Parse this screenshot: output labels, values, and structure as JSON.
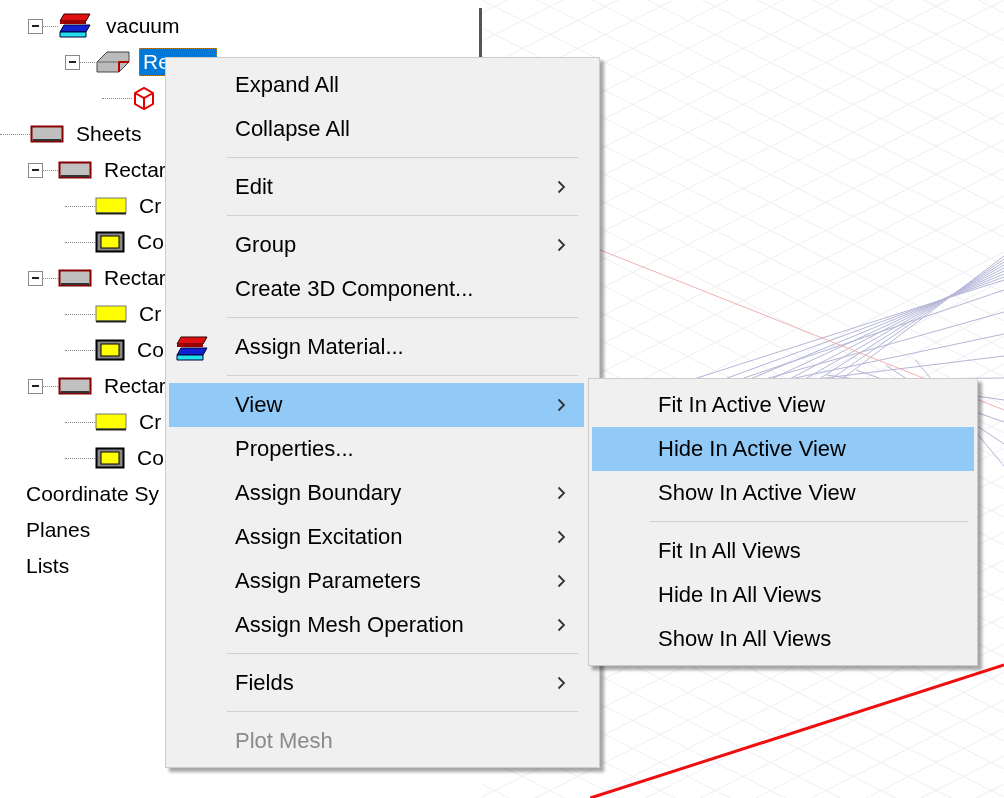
{
  "tree": {
    "partial_branch": [
      {
        "label": "vacuum",
        "kind": "material",
        "expanded": true,
        "selected": false,
        "children": [
          {
            "label": "Re",
            "kind": "solid",
            "expanded": true,
            "selected": true,
            "children": [
              {
                "kind": "wire",
                "selected": false
              }
            ]
          }
        ]
      }
    ],
    "items": [
      {
        "label": "Sheets",
        "kind": "sheet",
        "selected": false,
        "children": [
          {
            "label": "Rectar",
            "kind": "sheet",
            "expanded": true,
            "selected": false,
            "children": [
              {
                "label": "Cr",
                "kind": "face",
                "selected": false
              },
              {
                "label": "Co",
                "kind": "framed",
                "selected": false
              }
            ]
          },
          {
            "label": "Rectar",
            "kind": "sheet",
            "expanded": true,
            "selected": false,
            "children": [
              {
                "label": "Cr",
                "kind": "face",
                "selected": false
              },
              {
                "label": "Co",
                "kind": "framed",
                "selected": false
              }
            ]
          },
          {
            "label": "Rectar",
            "kind": "sheet",
            "expanded": true,
            "selected": false,
            "children": [
              {
                "label": "Cr",
                "kind": "face",
                "selected": false
              },
              {
                "label": "Co",
                "kind": "framed",
                "selected": false
              }
            ]
          }
        ]
      },
      {
        "label": "Coordinate Sy",
        "kind": "none",
        "selected": false
      },
      {
        "label": "Planes",
        "kind": "none",
        "selected": false
      },
      {
        "label": "Lists",
        "kind": "none",
        "selected": false
      }
    ]
  },
  "context_menu": {
    "groups": [
      [
        {
          "label": "Expand All",
          "kind": "text",
          "submenu": false,
          "selected": false,
          "disabled": false
        },
        {
          "label": "Collapse All",
          "kind": "text",
          "submenu": false,
          "selected": false,
          "disabled": false
        }
      ],
      [
        {
          "label": "Edit",
          "kind": "text",
          "submenu": true,
          "selected": false,
          "disabled": false
        }
      ],
      [
        {
          "label": "Group",
          "kind": "text",
          "submenu": true,
          "selected": false,
          "disabled": false
        },
        {
          "label": "Create 3D Component...",
          "kind": "text",
          "submenu": false,
          "selected": false,
          "disabled": false
        }
      ],
      [
        {
          "label": "Assign Material...",
          "kind": "icon",
          "submenu": false,
          "selected": false,
          "disabled": false
        }
      ],
      [
        {
          "label": "View",
          "kind": "text",
          "submenu": true,
          "selected": true,
          "disabled": false
        },
        {
          "label": "Properties...",
          "kind": "text",
          "submenu": false,
          "selected": false,
          "disabled": false
        },
        {
          "label": "Assign Boundary",
          "kind": "text",
          "submenu": true,
          "selected": false,
          "disabled": false
        },
        {
          "label": "Assign Excitation",
          "kind": "text",
          "submenu": true,
          "selected": false,
          "disabled": false
        },
        {
          "label": "Assign Parameters",
          "kind": "text",
          "submenu": true,
          "selected": false,
          "disabled": false
        },
        {
          "label": "Assign Mesh Operation",
          "kind": "text",
          "submenu": true,
          "selected": false,
          "disabled": false
        }
      ],
      [
        {
          "label": "Fields",
          "kind": "text",
          "submenu": true,
          "selected": false,
          "disabled": false
        }
      ],
      [
        {
          "label": "Plot Mesh",
          "kind": "text",
          "submenu": false,
          "selected": false,
          "disabled": true
        }
      ]
    ]
  },
  "view_submenu": {
    "groups": [
      [
        {
          "label": "Fit In Active View",
          "selected": false
        },
        {
          "label": "Hide In Active View",
          "selected": true
        },
        {
          "label": "Show In Active View",
          "selected": false
        }
      ],
      [
        {
          "label": "Fit In All Views",
          "selected": false
        },
        {
          "label": "Hide In All Views",
          "selected": false
        },
        {
          "label": "Show In All Views",
          "selected": false
        }
      ]
    ]
  }
}
